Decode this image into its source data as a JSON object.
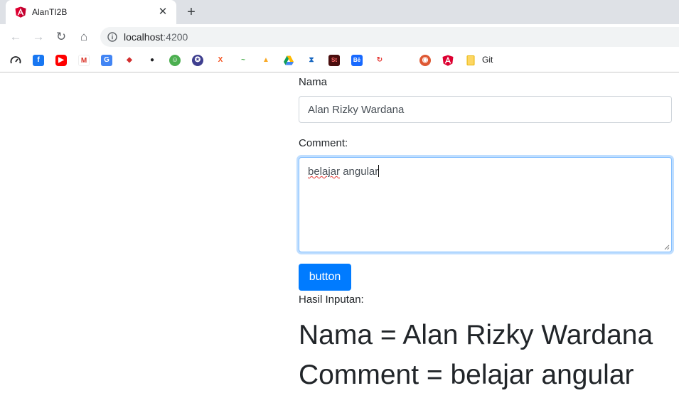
{
  "browser": {
    "tab_title": "AlanTI2B",
    "close_glyph": "✕",
    "new_tab_glyph": "+",
    "url_host": "localhost",
    "url_port": ":4200",
    "bookmark_git_label": "Git",
    "icons": {
      "back": "←",
      "forward": "→",
      "reload": "↻",
      "home": "⌂"
    }
  },
  "form": {
    "nama_label": "Nama",
    "nama_value": "Alan Rizky Wardana",
    "comment_label": "Comment:",
    "comment_word1": "belajar",
    "comment_word2": " angular",
    "button_label": "button",
    "hasil_label": "Hasil Inputan:"
  },
  "result": {
    "nama_line": "Nama = Alan Rizky Wardana",
    "comment_line": "Comment = belajar angular"
  },
  "colors": {
    "primary": "#007bff",
    "tabstrip": "#dee1e6",
    "text": "#212529"
  }
}
